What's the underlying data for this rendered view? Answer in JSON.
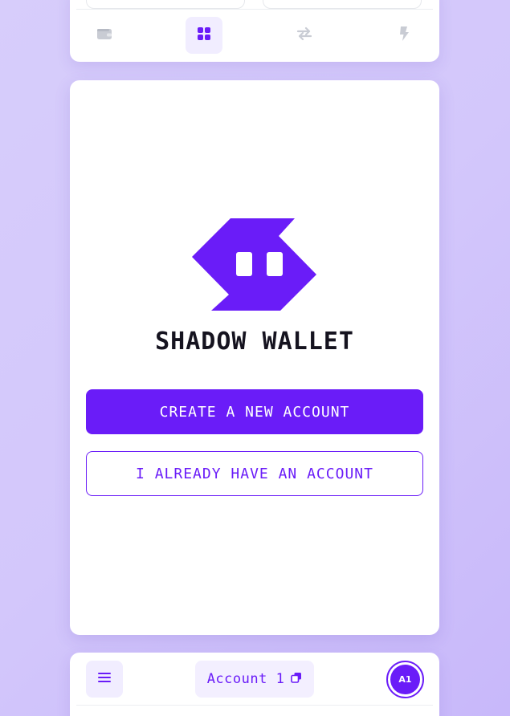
{
  "app": {
    "brand_name": "SHADOW WALLET",
    "accent_color": "#6a1cf8"
  },
  "top_nav": {
    "items": [
      {
        "icon": "wallet-icon",
        "active": false
      },
      {
        "icon": "apps-grid-icon",
        "active": true
      },
      {
        "icon": "swap-arrows-icon",
        "active": false
      },
      {
        "icon": "lightning-icon",
        "active": false
      }
    ]
  },
  "onboarding": {
    "logo_icon": "shadow-wallet-logo",
    "create_button_label": "CREATE A NEW ACCOUNT",
    "existing_button_label": "I ALREADY HAVE AN ACCOUNT"
  },
  "bottom_bar": {
    "menu_icon": "hamburger-menu-icon",
    "account_name": "Account 1",
    "copy_icon": "copy-icon",
    "avatar_initials": "A1"
  }
}
